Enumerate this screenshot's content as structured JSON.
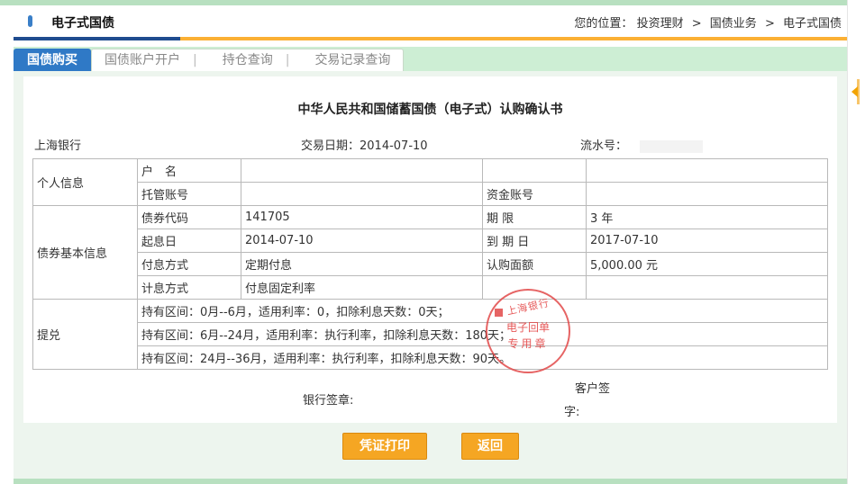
{
  "header": {
    "title": "电子式国债",
    "breadcrumb_prefix": "您的位置：",
    "breadcrumb": [
      "投资理财",
      "国债业务",
      "电子式国债"
    ],
    "breadcrumb_sep": ">"
  },
  "tabs": [
    {
      "label": "国债购买",
      "active": true
    },
    {
      "label": "国债账户开户",
      "active": false
    },
    {
      "label": "持仓查询",
      "active": false
    },
    {
      "label": "交易记录查询",
      "active": false
    }
  ],
  "form": {
    "title": "中华人民共和国储蓄国债（电子式）认购确认书",
    "bank": "上海银行",
    "trade_date_label": "交易日期：",
    "trade_date": "2014-07-10",
    "serial_label": "流水号：",
    "personal": {
      "section": "个人信息",
      "name_label": "户　名",
      "custody_label": "托管账号",
      "fund_label": "资金账号"
    },
    "bond": {
      "section": "债券基本信息",
      "code_label": "债券代码",
      "code": "141705",
      "term_label": "期 限",
      "term": "3 年",
      "start_label": "起息日",
      "start": "2014-07-10",
      "maturity_label": "到 期 日",
      "maturity": "2017-07-10",
      "pay_label": "付息方式",
      "pay": "定期付息",
      "amount_label": "认购面额",
      "amount": "5,000.00 元",
      "calc_label": "计息方式",
      "calc": "付息固定利率"
    },
    "redeem": {
      "section": "提兑",
      "rows": [
        "持有区间：0月--6月，适用利率：0，扣除利息天数：0天；",
        "持有区间：6月--24月，适用利率：执行利率，扣除利息天数：180天；",
        "持有区间：24月--36月，适用利率：执行利率，扣除利息天数：90天。"
      ]
    },
    "bank_sign_label": "银行签章:",
    "customer_sign_1": "客户签",
    "customer_sign_2": "字:",
    "seal": {
      "top": "上海银行",
      "mid": "电子回单",
      "bot": "专用章"
    }
  },
  "buttons": {
    "print": "凭证打印",
    "back": "返回"
  },
  "colors": {
    "accent": "#f5a623",
    "tab_active": "#2f79c6",
    "panel": "#edf5ee",
    "seal": "#e24a4a"
  }
}
